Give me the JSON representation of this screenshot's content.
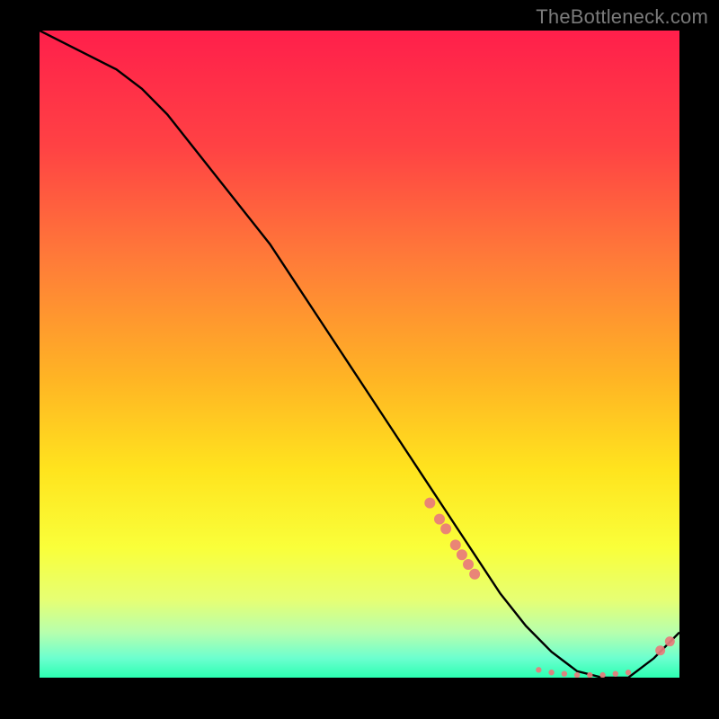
{
  "attribution": "TheBottleneck.com",
  "cluster_label": "",
  "chart_data": {
    "type": "line",
    "title": "",
    "xlabel": "",
    "ylabel": "",
    "xlim": [
      0,
      100
    ],
    "ylim": [
      0,
      100
    ],
    "curve": {
      "x": [
        0,
        4,
        8,
        12,
        16,
        20,
        24,
        28,
        32,
        36,
        40,
        44,
        48,
        52,
        56,
        60,
        64,
        68,
        72,
        76,
        80,
        84,
        88,
        92,
        96,
        100
      ],
      "y": [
        100,
        98,
        96,
        94,
        91,
        87,
        82,
        77,
        72,
        67,
        61,
        55,
        49,
        43,
        37,
        31,
        25,
        19,
        13,
        8,
        4,
        1,
        0,
        0,
        3,
        7
      ]
    },
    "dense_points": {
      "x": [
        61,
        62.5,
        63.5,
        65,
        66,
        67,
        68
      ],
      "y": [
        27,
        24.5,
        23,
        20.5,
        19,
        17.5,
        16
      ],
      "r": 6,
      "color": "#e87b7b"
    },
    "flat_cluster": {
      "x": [
        78,
        80,
        82,
        84,
        86,
        88,
        90,
        92
      ],
      "y": [
        1.2,
        0.8,
        0.6,
        0.4,
        0.4,
        0.4,
        0.6,
        0.8
      ],
      "r": 3.2,
      "color": "#e87b7b"
    },
    "tail_points": {
      "x": [
        97,
        98.5
      ],
      "y": [
        4.2,
        5.6
      ],
      "r": 5.5,
      "color": "#e87b7b"
    },
    "colors": {
      "curve": "#000000",
      "point": "#e87b7b"
    }
  }
}
